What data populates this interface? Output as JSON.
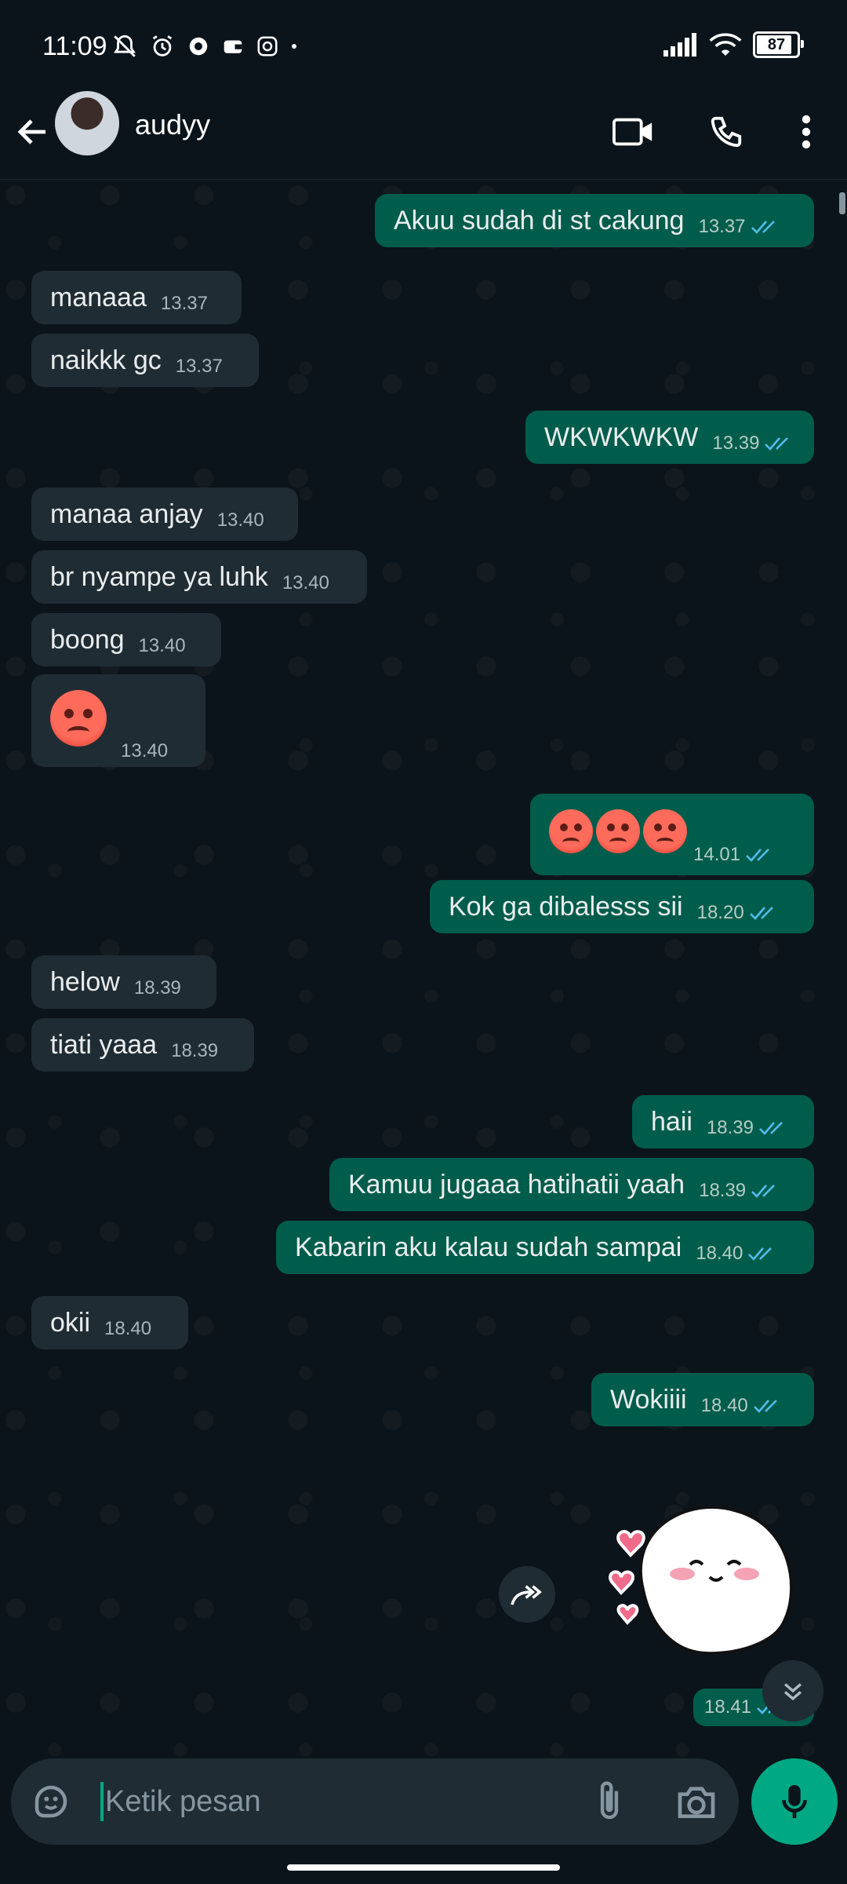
{
  "status_bar": {
    "time": "11:09",
    "battery": "87",
    "icons": [
      "mute-bell-icon",
      "alarm-icon",
      "app-icon",
      "wallet-icon",
      "instagram-icon",
      "dot-icon"
    ],
    "right_icons": [
      "signal-icon",
      "wifi-icon",
      "battery-icon"
    ]
  },
  "header": {
    "contact_name": "audyy",
    "actions": [
      "video-call-icon",
      "voice-call-icon",
      "more-options-icon"
    ]
  },
  "messages": [
    {
      "dir": "out",
      "text": "Akuu sudah di st cakung",
      "time": "13.37",
      "read": true
    },
    {
      "dir": "in",
      "text": "manaaa",
      "time": "13.37"
    },
    {
      "dir": "in",
      "text": "naikkk gc",
      "time": "13.37"
    },
    {
      "dir": "out",
      "text": "WKWKWKW",
      "time": "13.39",
      "read": true
    },
    {
      "dir": "in",
      "text": "manaa anjay",
      "time": "13.40"
    },
    {
      "dir": "in",
      "text": "br nyampe ya luhk",
      "time": "13.40"
    },
    {
      "dir": "in",
      "text": "boong",
      "time": "13.40"
    },
    {
      "dir": "in",
      "text": "",
      "emoji": "angry-face",
      "time": "13.40"
    },
    {
      "dir": "out",
      "text": "",
      "emoji": "angry-face-x3",
      "time": "14.01",
      "read": true
    },
    {
      "dir": "out",
      "text": "Kok ga dibalesss sii",
      "time": "18.20",
      "read": true
    },
    {
      "dir": "in",
      "text": "helow",
      "time": "18.39"
    },
    {
      "dir": "in",
      "text": "tiati yaaa",
      "time": "18.39"
    },
    {
      "dir": "out",
      "text": "haii",
      "time": "18.39",
      "read": true
    },
    {
      "dir": "out",
      "text": "Kamuu jugaaa hatihatii yaah",
      "time": "18.39",
      "read": true
    },
    {
      "dir": "out",
      "text": "Kabarin aku kalau sudah sampai",
      "time": "18.40",
      "read": true
    },
    {
      "dir": "in",
      "text": "okii",
      "time": "18.40"
    },
    {
      "dir": "out",
      "text": "Wokiiii",
      "time": "18.40",
      "read": true
    },
    {
      "dir": "out",
      "text": "",
      "sticker": "blushing-sticker",
      "time": "18.41",
      "read": true
    }
  ],
  "composer": {
    "placeholder": "Ketik pesan"
  },
  "colors": {
    "background": "#0b141a",
    "incoming": "#202c33",
    "outgoing": "#005c4b",
    "accent": "#00a884",
    "read_tick": "#53bdeb"
  }
}
